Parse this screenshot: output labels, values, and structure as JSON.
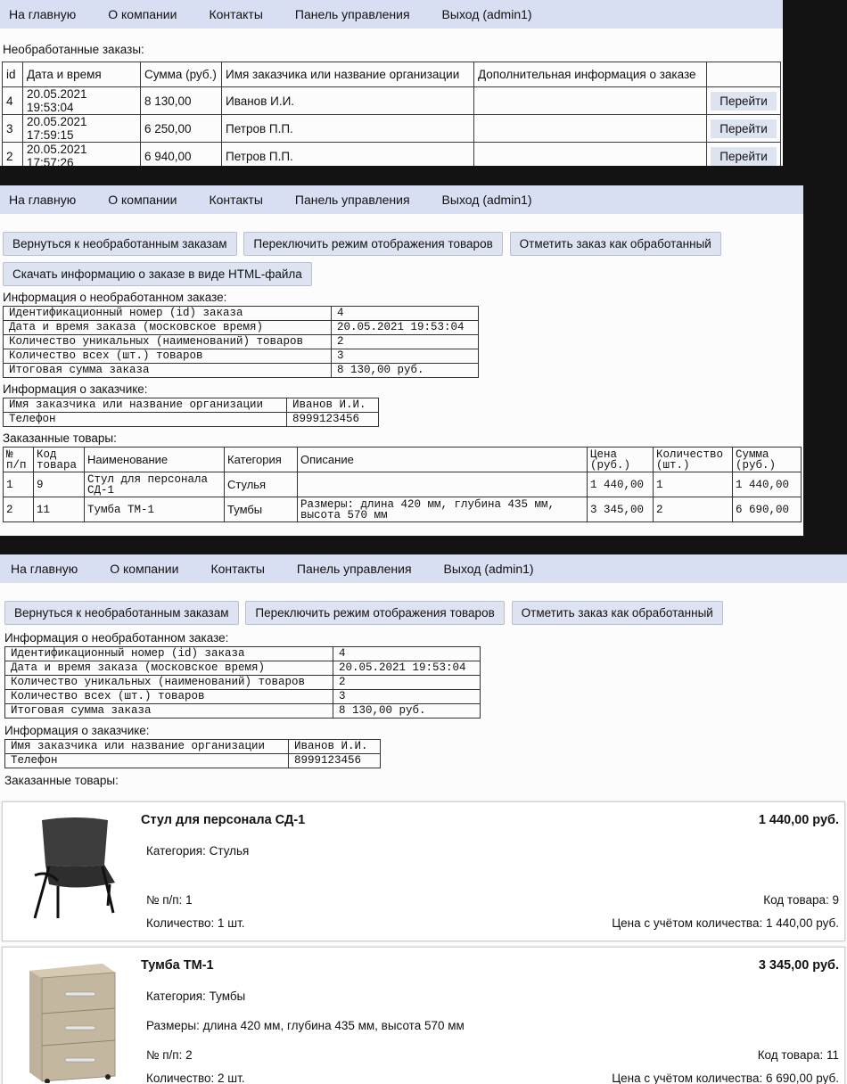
{
  "nav": [
    "На главную",
    "О компании",
    "Контакты",
    "Панель управления",
    "Выход (admin1)"
  ],
  "orders_page": {
    "heading": "Необработанные заказы:",
    "columns": [
      "id",
      "Дата и время",
      "Сумма (руб.)",
      "Имя заказчика или название организации",
      "Дополнительная информация о заказе",
      ""
    ],
    "rows": [
      {
        "id": "4",
        "datetime": "20.05.2021 19:53:04",
        "sum": "8 130,00",
        "customer": "Иванов И.И.",
        "extra": "",
        "action": "Перейти"
      },
      {
        "id": "3",
        "datetime": "20.05.2021 17:59:15",
        "sum": "6 250,00",
        "customer": "Петров П.П.",
        "extra": "",
        "action": "Перейти"
      },
      {
        "id": "2",
        "datetime": "20.05.2021 17:57:26",
        "sum": "6 940,00",
        "customer": "Петров П.П.",
        "extra": "",
        "action": "Перейти"
      }
    ]
  },
  "order_buttons": {
    "back": "Вернуться к необработанным заказам",
    "toggle": "Переключить режим отображения товаров",
    "mark": "Отметить заказ как обработанный",
    "download": "Скачать информацию о заказе в виде HTML-файла"
  },
  "order_info": {
    "heading": "Информация о необработанном заказе:",
    "rows": [
      [
        "Идентификационный номер (id) заказа",
        "4"
      ],
      [
        "Дата и время заказа (московское время)",
        "20.05.2021 19:53:04"
      ],
      [
        "Количество уникальных (наименований) товаров",
        "2"
      ],
      [
        "Количество всех (шт.) товаров",
        "3"
      ],
      [
        "Итоговая сумма заказа",
        "8 130,00 руб."
      ]
    ]
  },
  "customer_info": {
    "heading": "Информация о заказчике:",
    "rows": [
      [
        "Имя заказчика или название организации",
        "Иванов И.И."
      ],
      [
        "Телефон",
        "8999123456"
      ]
    ]
  },
  "ordered_items": {
    "heading": "Заказанные товары:",
    "columns": [
      "№ п/п",
      "Код товара",
      "Наименование",
      "Категория",
      "Описание",
      "Цена (руб.)",
      "Количество (шт.)",
      "Сумма (руб.)"
    ],
    "rows": [
      [
        "1",
        "9",
        "Стул для персонала СД-1",
        "Стулья",
        "",
        "1 440,00",
        "1",
        "1 440,00"
      ],
      [
        "2",
        "11",
        "Тумба ТМ-1",
        "Тумбы",
        "Размеры: длина 420 мм, глубина 435 мм, высота 570 мм",
        "3 345,00",
        "2",
        "6 690,00"
      ]
    ]
  },
  "cards": [
    {
      "name": "Стул для персонала СД-1",
      "price": "1 440,00 руб.",
      "category": "Категория: Стулья",
      "description": "",
      "num": "№ п/п: 1",
      "code": "Код товара: 9",
      "qty": "Количество: 1 шт.",
      "total": "Цена с учётом количества: 1 440,00 руб.",
      "image": "office-chair-photo"
    },
    {
      "name": "Тумба ТМ-1",
      "price": "3 345,00 руб.",
      "category": "Категория: Тумбы",
      "description": "Размеры: длина 420 мм, глубина 435 мм, высота 570 мм",
      "num": "№ п/п: 2",
      "code": "Код товара: 11",
      "qty": "Количество: 2 шт.",
      "total": "Цена с учётом количества: 6 690,00 руб.",
      "image": "drawer-cabinet-photo"
    }
  ],
  "colors": {
    "nav_bg": "#d9dff2",
    "button_bg": "#dde3f1",
    "background": "#131313"
  }
}
